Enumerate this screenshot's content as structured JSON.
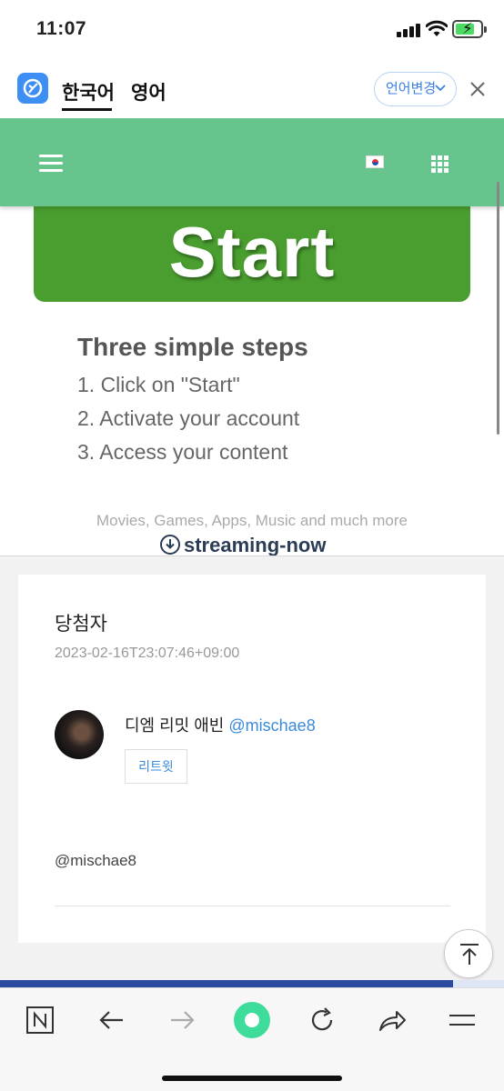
{
  "status_bar": {
    "time": "11:07"
  },
  "translate_bar": {
    "tab_korean": "한국어",
    "tab_english": "영어",
    "language_button": "언어변경"
  },
  "ad": {
    "start_label": "Start",
    "steps_title": "Three simple steps",
    "steps": [
      "1. Click on \"Start\"",
      "2. Activate your account",
      "3. Access your content"
    ],
    "caption": "Movies, Games, Apps, Music and much more",
    "brand": "streaming-now"
  },
  "card": {
    "title": "당첨자",
    "date": "2023-02-16T23:07:46+09:00",
    "user_name": "디엠 리밋 애빈",
    "user_handle": "@mischae8",
    "retweet_label": "리트윗",
    "mention": "@mischae8"
  },
  "colors": {
    "site_nav": "#66c48c",
    "start_button": "#4a9e2f",
    "link": "#3b8ad9",
    "reload_button": "#3ddc9a"
  }
}
